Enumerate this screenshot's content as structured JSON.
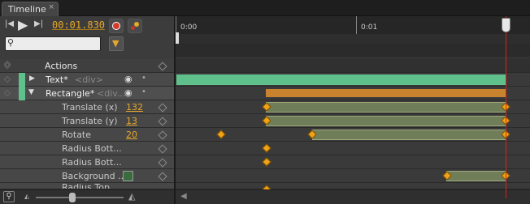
{
  "tab": {
    "title": "Timeline",
    "close_glyph": "×"
  },
  "transport": {
    "timecode": "00:01.830"
  },
  "search": {
    "placeholder": ""
  },
  "ruler": {
    "labels": [
      "0:00",
      "0:01"
    ]
  },
  "rows": [
    {
      "label": "Actions"
    },
    {
      "label": "Text*",
      "tag": "<div>",
      "color": "#5fc08c"
    },
    {
      "label": "Rectangle*",
      "tag": "<div...",
      "color": "#5fc08c"
    },
    {
      "label": "Translate (x)",
      "value": "132"
    },
    {
      "label": "Translate (y)",
      "value": "13"
    },
    {
      "label": "Rotate",
      "value": "20"
    },
    {
      "label": "Radius Bott..."
    },
    {
      "label": "Radius Bott..."
    },
    {
      "label": "Background ..."
    },
    {
      "label": "Radius Top..."
    }
  ],
  "colors": {
    "accent": "#e6a82a",
    "text_bar": "#5fc08c",
    "rect_bar": "#c9822d",
    "anim_bar": "#6f7e58",
    "playhead": "#d0271d"
  }
}
